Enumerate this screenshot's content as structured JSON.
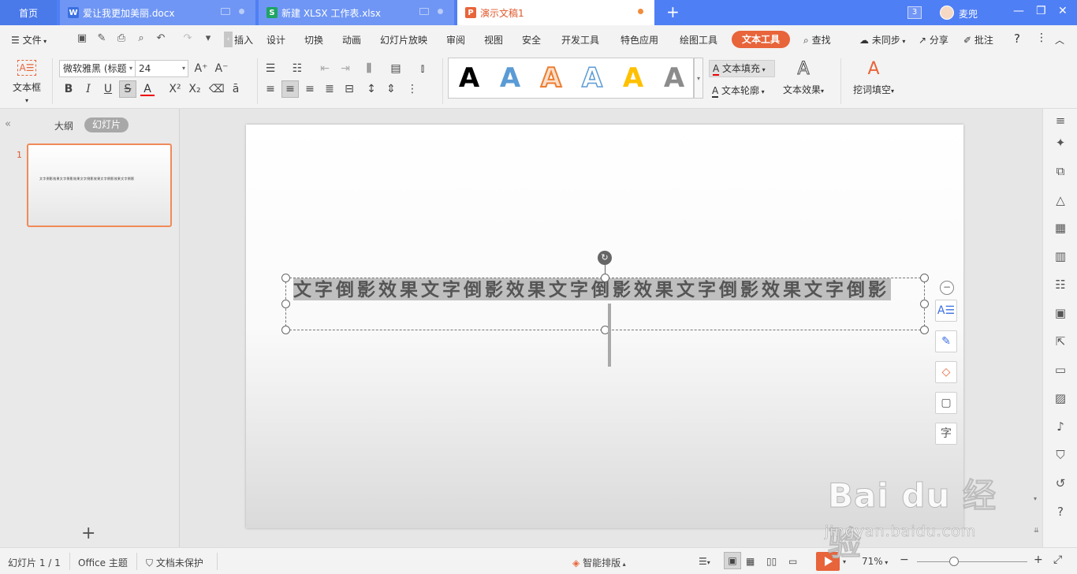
{
  "tabs": {
    "home": "首页",
    "doc": "爱让我更加美丽.docx",
    "xls": "新建 XLSX 工作表.xlsx",
    "ppt": "演示文稿1",
    "window_count": "3",
    "user": "麦兜"
  },
  "menu": {
    "file": "文件",
    "insert": "插入",
    "items": [
      "设计",
      "切换",
      "动画",
      "幻灯片放映",
      "审阅",
      "视图",
      "安全",
      "开发工具",
      "特色应用",
      "绘图工具",
      "文本工具"
    ],
    "search": "查找",
    "sync": "未同步",
    "share": "分享",
    "comment": "批注",
    "help": "?"
  },
  "ribbon": {
    "textbox_label": "文本框",
    "font_name": "微软雅黑 (标题",
    "font_size": "24",
    "text_fill": "文本填充",
    "text_outline": "文本轮廓",
    "text_effects": "文本效果",
    "cloze": "挖词填空",
    "styles": [
      {
        "letter": "A",
        "color": "#000000",
        "kind": "solid"
      },
      {
        "letter": "A",
        "color": "#5b9bd5",
        "kind": "solid"
      },
      {
        "letter": "A",
        "color": "#ed7d31",
        "kind": "outline-fill"
      },
      {
        "letter": "A",
        "color": "#5b9bd5",
        "kind": "outline"
      },
      {
        "letter": "A",
        "color": "#ffc000",
        "kind": "solid"
      },
      {
        "letter": "A",
        "color": "#7f7f7f",
        "kind": "gradient"
      }
    ]
  },
  "leftpanel": {
    "outline": "大纲",
    "slides": "幻灯片",
    "slide_number": "1",
    "thumb_text": "文字倒影效果文字倒影效果文字倒影效果文字倒影效果文字倒影"
  },
  "slide": {
    "text": "文字倒影效果文字倒影效果文字倒影效果文字倒影效果文字倒影"
  },
  "status": {
    "slide_count": "幻灯片 1 / 1",
    "theme": "Office 主题",
    "protect": "文档未保护",
    "smart_layout": "智能排版",
    "zoom": "71%"
  },
  "watermark": {
    "logo": "Bai du 经验",
    "url": "jingyan.baidu.com"
  },
  "colors": {
    "titlebar": "#4f7ff4",
    "accent": "#e8643a"
  }
}
